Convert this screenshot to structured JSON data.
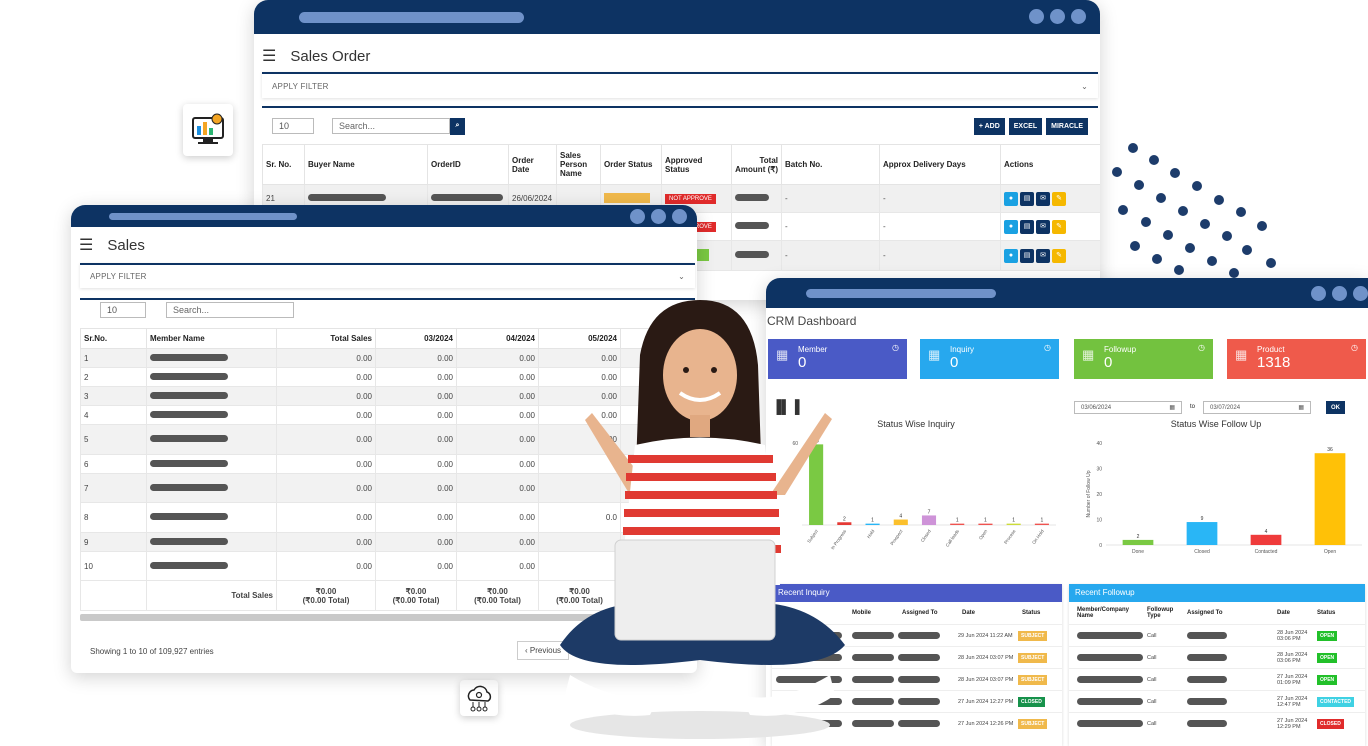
{
  "sales_order": {
    "title": "Sales Order",
    "filter_label": "APPLY FILTER",
    "page_size": "10",
    "search_placeholder": "Search...",
    "buttons": {
      "add": "+ ADD",
      "excel": "EXCEL",
      "miracle": "MIRACLE"
    },
    "columns": [
      "Sr. No.",
      "Buyer Name",
      "OrderID",
      "Order Date",
      "Sales Person Name",
      "Order Status",
      "Approved Status",
      "Total Amount (₹)",
      "Batch No.",
      "Approx Delivery Days",
      "Actions"
    ],
    "rows": [
      {
        "sr": "21",
        "date": "26/06/2024",
        "approve": "NOT APPROVE",
        "batch": "-",
        "days": "-"
      },
      {
        "sr": "",
        "date": "",
        "approve": "NOT APPROVE",
        "batch": "-",
        "days": "-"
      },
      {
        "sr": "",
        "date": "",
        "approve": "",
        "batch": "-",
        "days": "-"
      }
    ]
  },
  "sales": {
    "title": "Sales",
    "filter_label": "APPLY FILTER",
    "page_size": "10",
    "search_placeholder": "Search...",
    "columns": [
      "Sr.No.",
      "Member Name",
      "Total Sales",
      "03/2024",
      "04/2024",
      "05/2024"
    ],
    "rows": [
      {
        "sr": "1",
        "total": "0.00",
        "m3": "0.00",
        "m4": "0.00",
        "m5": "0.00"
      },
      {
        "sr": "2",
        "total": "0.00",
        "m3": "0.00",
        "m4": "0.00",
        "m5": "0.00"
      },
      {
        "sr": "3",
        "total": "0.00",
        "m3": "0.00",
        "m4": "0.00",
        "m5": "0.00"
      },
      {
        "sr": "4",
        "total": "0.00",
        "m3": "0.00",
        "m4": "0.00",
        "m5": "0.00"
      },
      {
        "sr": "5",
        "total": "0.00",
        "m3": "0.00",
        "m4": "0.00",
        "m5": "0.00"
      },
      {
        "sr": "6",
        "total": "0.00",
        "m3": "0.00",
        "m4": "0.00",
        "m5": ""
      },
      {
        "sr": "7",
        "total": "0.00",
        "m3": "0.00",
        "m4": "0.00",
        "m5": ""
      },
      {
        "sr": "8",
        "total": "0.00",
        "m3": "0.00",
        "m4": "0.00",
        "m5": "0.0"
      },
      {
        "sr": "9",
        "total": "0.00",
        "m3": "0.00",
        "m4": "0.00",
        "m5": ""
      },
      {
        "sr": "10",
        "total": "0.00",
        "m3": "0.00",
        "m4": "0.00",
        "m5": ""
      }
    ],
    "total_label": "Total Sales",
    "total_value": "₹0.00",
    "total_sub": "(₹0.00 Total)",
    "showing": "Showing 1 to 10 of 109,927 entries",
    "previous": "‹  Previous"
  },
  "crm": {
    "title": "CRM Dashboard",
    "cards": [
      {
        "label": "Member",
        "value": "0",
        "color": "#4a5ac6"
      },
      {
        "label": "Inquiry",
        "value": "0",
        "color": "#27a8ee"
      },
      {
        "label": "Followup",
        "value": "0",
        "color": "#73c23f"
      },
      {
        "label": "Product",
        "value": "1318",
        "color": "#ef5a4b"
      }
    ],
    "date_from": "03/06/2024",
    "date_to": "03/07/2024",
    "to_label": "to",
    "ok": "OK",
    "recent_inquiry_title": "Recent Inquiry",
    "inquiry_columns": [
      "Mobile",
      "Assigned To",
      "Date",
      "Status"
    ],
    "inquiry_rows": [
      {
        "date": "29 Jun 2024 11:22 AM",
        "status": "SUBJECT",
        "color": "#f0b94b"
      },
      {
        "date": "28 Jun 2024 03:07 PM",
        "status": "SUBJECT",
        "color": "#f0b94b"
      },
      {
        "date": "28 Jun 2024 03:07 PM",
        "status": "SUBJECT",
        "color": "#f0b94b"
      },
      {
        "date": "27 Jun 2024 12:27 PM",
        "status": "CLOSED",
        "color": "#17924b"
      },
      {
        "date": "27 Jun 2024 12:26 PM",
        "status": "SUBJECT",
        "color": "#f0b94b"
      }
    ],
    "recent_followup_title": "Recent Followup",
    "followup_columns": [
      "Member/Company Name",
      "Followup Type",
      "Assigned To",
      "Date",
      "Status"
    ],
    "followup_rows": [
      {
        "type": "Call",
        "date": "28 Jun 2024 03:06 PM",
        "status": "OPEN",
        "color": "#22c02a"
      },
      {
        "type": "Call",
        "date": "28 Jun 2024 03:06 PM",
        "status": "OPEN",
        "color": "#22c02a"
      },
      {
        "type": "Call",
        "date": "27 Jun 2024 01:09 PM",
        "status": "OPEN",
        "color": "#22c02a"
      },
      {
        "type": "Call",
        "date": "27 Jun 2024 12:47 PM",
        "status": "CONTACTED",
        "color": "#3fd1e3"
      },
      {
        "type": "Call",
        "date": "27 Jun 2024 12:29 PM",
        "status": "CLOSED",
        "color": "#e02b2b"
      }
    ]
  },
  "chart_data": [
    {
      "type": "bar",
      "title": "Status Wise Inquiry",
      "categories": [
        "Subject",
        "In Progress",
        "Hold",
        "Prospect",
        "Closed",
        "Call leads",
        "Open",
        "Process",
        "On Hold"
      ],
      "values": [
        59,
        2,
        1,
        4,
        7,
        1,
        1,
        1,
        1
      ],
      "colors": [
        "#7ac943",
        "#e53935",
        "#29b6f6",
        "#fbc02d",
        "#ce93d8",
        "#ef5350",
        "#ef5350",
        "#cddc39",
        "#ef5350"
      ],
      "ylim": [
        0,
        60
      ],
      "yticks": [
        "60"
      ]
    },
    {
      "type": "bar",
      "title": "Status Wise Follow Up",
      "ylabel": "Number of Follow Up",
      "categories": [
        "Done",
        "Closed",
        "Contacted",
        "Open"
      ],
      "values": [
        2,
        9,
        4,
        36
      ],
      "colors": [
        "#7ac943",
        "#29b6f6",
        "#ef3b3b",
        "#ffc107"
      ],
      "ylim": [
        0,
        40
      ],
      "yticks": [
        "0",
        "10",
        "20",
        "30",
        "40"
      ]
    }
  ]
}
